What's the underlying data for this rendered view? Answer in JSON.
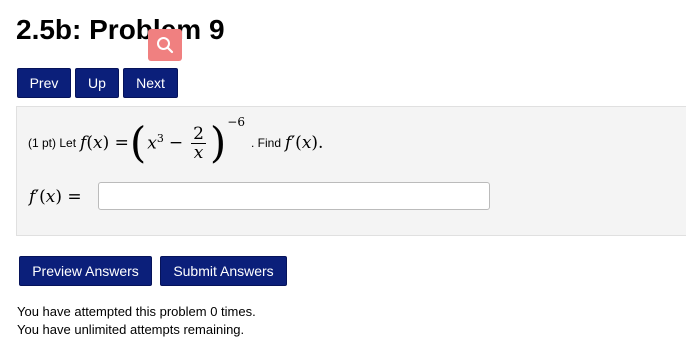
{
  "page": {
    "title": "2.5b: Problem 9"
  },
  "nav": {
    "prev_label": "Prev",
    "up_label": "Up",
    "next_label": "Next"
  },
  "problem": {
    "points_prefix": "(1 pt) Let",
    "fx": "f(x) =",
    "base_var": "x",
    "base_exp": "3",
    "minus": "−",
    "frac_num": "2",
    "frac_den": "x",
    "outer_exp": "−6",
    "find_text": ". Find",
    "find_expr": "f′(x).",
    "answer_label": "f′(x) =",
    "answer_value": ""
  },
  "actions": {
    "preview_label": "Preview Answers",
    "submit_label": "Submit Answers"
  },
  "status": {
    "attempts": "You have attempted this problem 0 times.",
    "remaining": "You have unlimited attempts remaining."
  },
  "colors": {
    "button_bg": "#0b1f7a",
    "search_badge": "#f08080",
    "problem_bg": "#f4f4f4"
  },
  "icons": {
    "search": "search-icon"
  }
}
